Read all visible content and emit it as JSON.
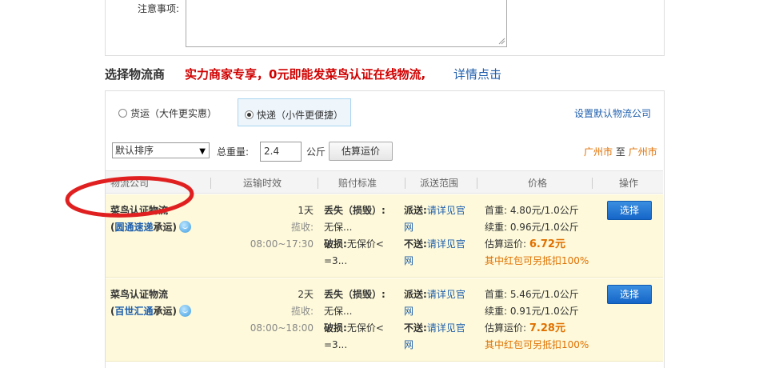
{
  "notes": {
    "label": "注意事项:",
    "value": ""
  },
  "section": {
    "title": "选择物流商",
    "promo": "实力商家专享，0元即能发菜鸟认证在线物流,",
    "promo_link": "详情点击"
  },
  "options": {
    "freight_label": "货运（大件更实惠）",
    "express_label": "快递（小件更便捷）",
    "selected": "express",
    "default_link": "设置默认物流公司"
  },
  "filters": {
    "sort_value": "默认排序",
    "weight_label": "总重量:",
    "weight_value": "2.4",
    "weight_unit": "公斤",
    "calc_button": "估算运价",
    "route_from": "广州市",
    "route_to_word": "至",
    "route_to": "广州市"
  },
  "table": {
    "headers": [
      "物流公司",
      "运输时效",
      "赔付标准",
      "派送范围",
      "价格",
      "操作"
    ],
    "rows": [
      {
        "name": "菜鸟认证物流",
        "carrier_open": "(",
        "carrier": "圆通速递",
        "carrier_close": "承运)",
        "days": "1天",
        "pickup": "揽收: 08:00~17:30",
        "loss_label": "丢失（损毁）:",
        "loss_value": "无保...",
        "damage_label": "破损:",
        "damage_value_1": "无保价<",
        "damage_value_2": "=3...",
        "deliver_label": "派送:",
        "deliver_link_1": "请详见官",
        "deliver_link_2": "网",
        "nodeliver_label": "不送:",
        "nodeliver_link_1": "请详见官",
        "nodeliver_link_2": "网",
        "first_weight": "首重: 4.80元/1.0公斤",
        "extra_weight": "续重: 0.96元/1.0公斤",
        "est_label": "估算运价:",
        "est_value": "6.72元",
        "redpacket": "其中红包可另抵扣100%",
        "action": "选择"
      },
      {
        "name": "菜鸟认证物流",
        "carrier_open": "(",
        "carrier": "百世汇通",
        "carrier_close": "承运)",
        "days": "2天",
        "pickup": "揽收: 08:00~18:00",
        "loss_label": "丢失（损毁）:",
        "loss_value": "无保...",
        "damage_label": "破损:",
        "damage_value_1": "无保价<",
        "damage_value_2": "=3...",
        "deliver_label": "派送:",
        "deliver_link_1": "请详见官",
        "deliver_link_2": "网",
        "nodeliver_label": "不送:",
        "nodeliver_link_1": "请详见官",
        "nodeliver_link_2": "网",
        "first_weight": "首重: 5.46元/1.0公斤",
        "extra_weight": "续重: 0.91元/1.0公斤",
        "est_label": "估算运价:",
        "est_value": "7.28元",
        "redpacket": "其中红包可另抵扣100%",
        "action": "选择"
      }
    ]
  },
  "colors": {
    "accent_red": "#d00000",
    "link_blue": "#1f5fad",
    "price_orange": "#e07000",
    "row_bg": "#fdf9da",
    "annotation_red": "#e02020"
  }
}
